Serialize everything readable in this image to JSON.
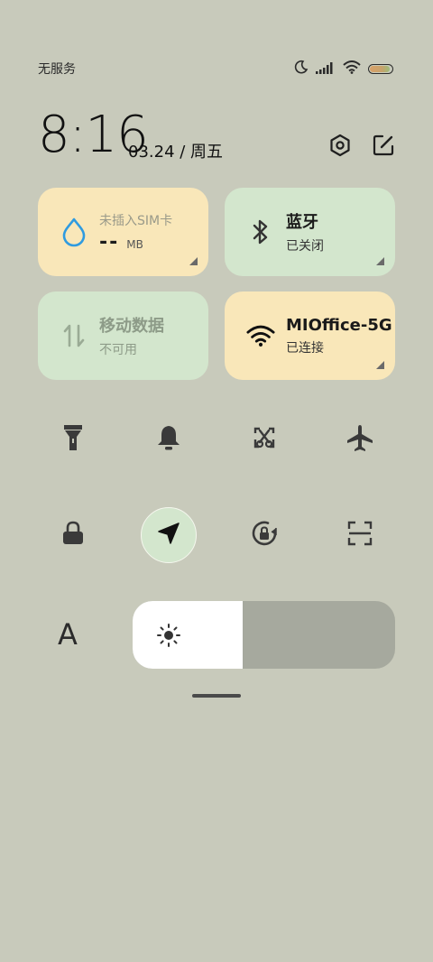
{
  "status_bar": {
    "carrier": "无服务",
    "icons": [
      "moon-icon",
      "signal-icon",
      "wifi-icon",
      "battery-icon"
    ],
    "battery_level": 0.9
  },
  "header": {
    "time": "8:16",
    "date": "03.24 / 周五",
    "actions": [
      "settings-icon",
      "edit-icon"
    ]
  },
  "tiles": {
    "data_usage": {
      "title": "未插入SIM卡",
      "value": "--",
      "unit": "MB",
      "icon": "droplet-icon",
      "color": "#f9e7b9"
    },
    "bluetooth": {
      "title": "蓝牙",
      "status": "已关闭",
      "icon": "bluetooth-icon",
      "color": "#d3e6cd"
    },
    "mobile_data": {
      "title": "移动数据",
      "status": "不可用",
      "icon": "updown-arrows-icon",
      "color": "#d3e6cd"
    },
    "wifi": {
      "title": "MIOffice-5G",
      "status": "已连接",
      "icon": "wifi-icon",
      "color": "#f9e7b9"
    }
  },
  "toggles": [
    {
      "name": "flashlight",
      "icon": "flashlight-icon",
      "active": false
    },
    {
      "name": "sound",
      "icon": "bell-icon",
      "active": false
    },
    {
      "name": "screenshot",
      "icon": "scissors-screenshot-icon",
      "active": false
    },
    {
      "name": "airplane",
      "icon": "airplane-icon",
      "active": false
    },
    {
      "name": "lock",
      "icon": "lock-icon",
      "active": false
    },
    {
      "name": "location",
      "icon": "location-arrow-icon",
      "active": true
    },
    {
      "name": "rotation-lock",
      "icon": "rotation-lock-icon",
      "active": false
    },
    {
      "name": "scanner",
      "icon": "scan-icon",
      "active": false
    }
  ],
  "brightness": {
    "font_label": "A",
    "level": 0.42,
    "icon": "sun-icon"
  }
}
